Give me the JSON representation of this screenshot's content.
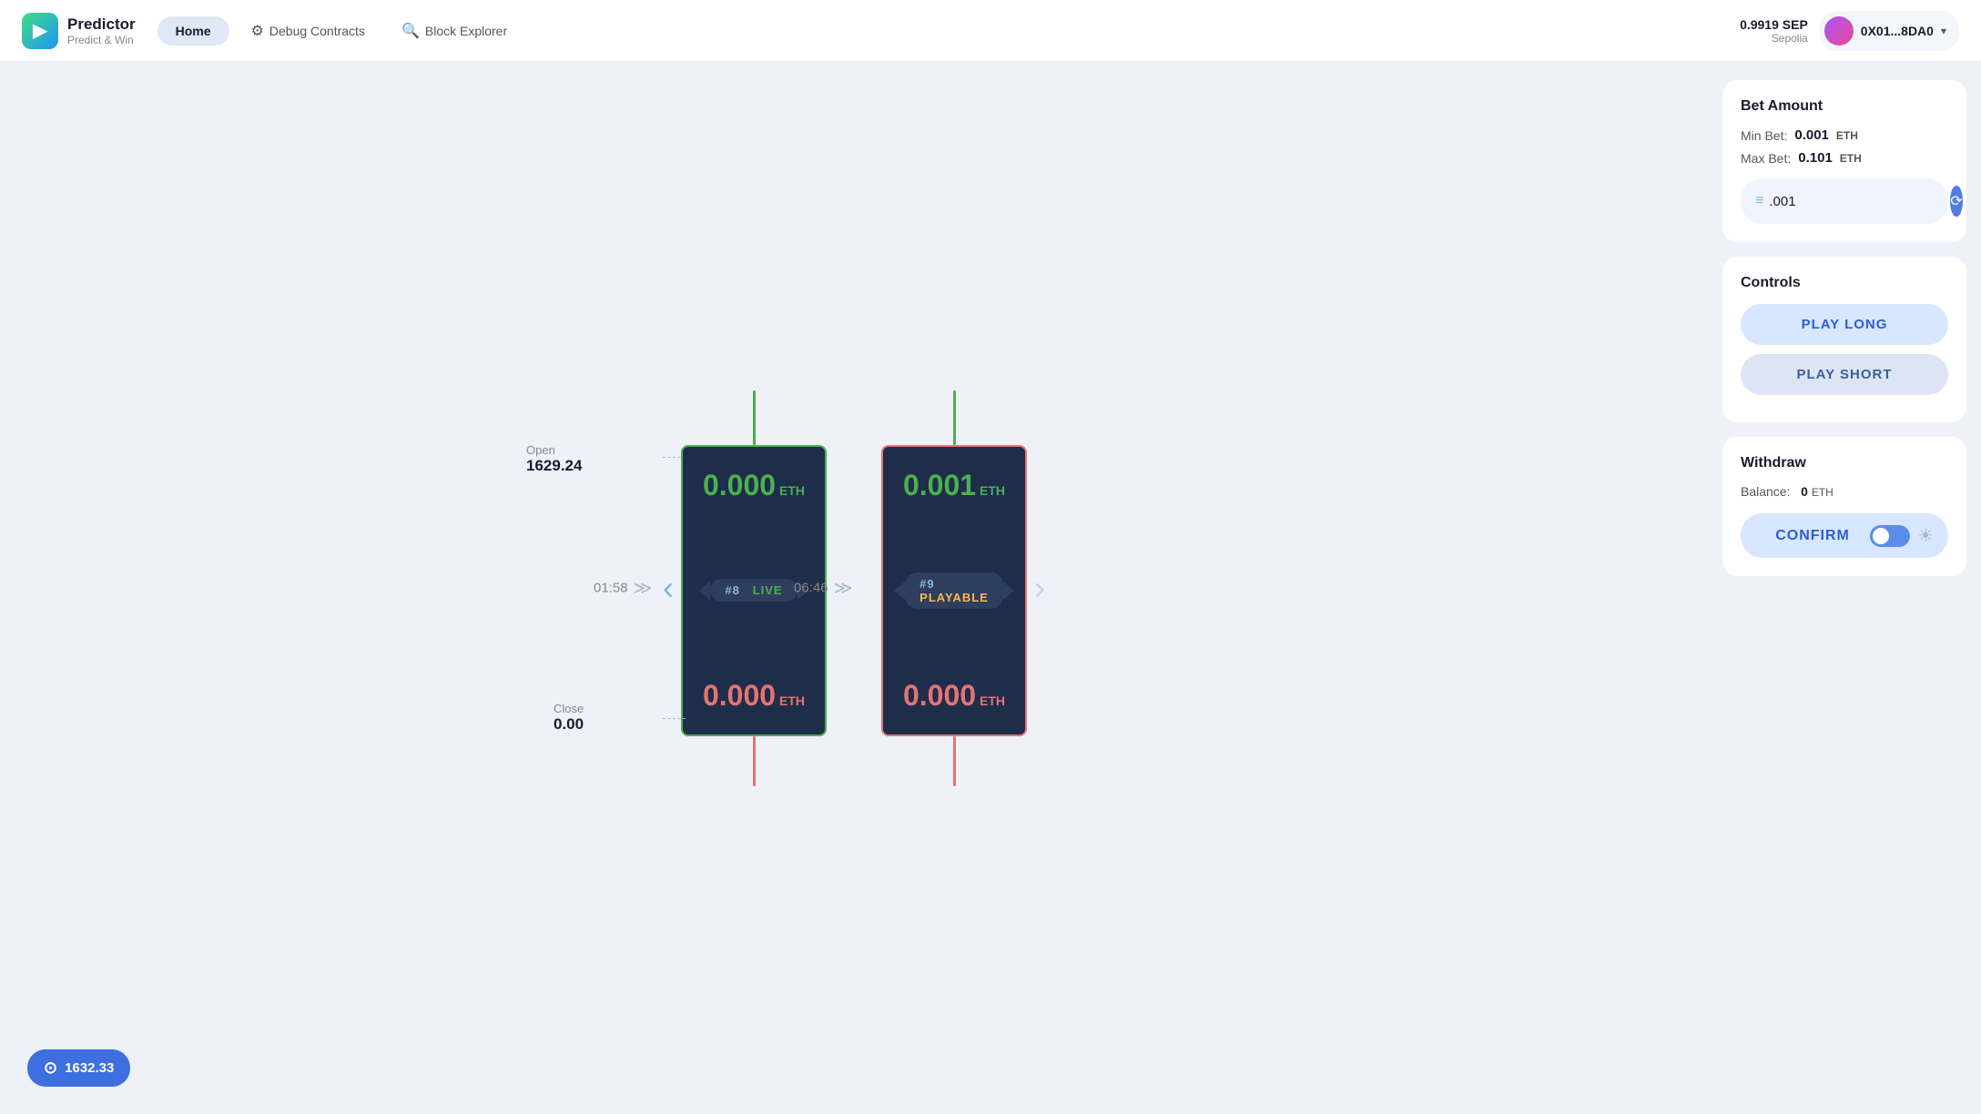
{
  "app": {
    "logo_title": "Predictor",
    "logo_sub": "Predict & Win"
  },
  "nav": {
    "home": "Home",
    "debug": "Debug Contracts",
    "explorer": "Block Explorer",
    "balance": "0.9919 SEP",
    "network": "Sepolia",
    "wallet_address": "0X01...8DA0"
  },
  "candles": [
    {
      "id": "candle-8",
      "badge_number": "#8",
      "badge_status": "LIVE",
      "badge_color": "green",
      "timer": "01:58",
      "top_value": "0.000",
      "bottom_value": "0.000",
      "eth_label": "ETH",
      "wick_top_color": "green",
      "wick_bottom_color": "red",
      "open_label": "Open",
      "open_price": "1629.24",
      "close_label": "Close",
      "close_price": "0.00"
    },
    {
      "id": "candle-9",
      "badge_number": "#9",
      "badge_status": "PLAYABLE",
      "badge_color": "orange",
      "timer": "06:46",
      "top_value": "0.001",
      "bottom_value": "0.000",
      "eth_label": "ETH",
      "wick_top_color": "green",
      "wick_bottom_color": "red"
    }
  ],
  "bet_amount": {
    "title": "Bet Amount",
    "min_label": "Min Bet:",
    "min_value": "0.001",
    "min_unit": "ETH",
    "max_label": "Max Bet:",
    "max_value": "0.101",
    "max_unit": "ETH",
    "input_value": ".001",
    "input_icon": "≡",
    "refresh_icon": "⟳"
  },
  "controls": {
    "title": "Controls",
    "play_long": "PLAY LONG",
    "play_short": "PLAY SHORT"
  },
  "withdraw": {
    "title": "Withdraw",
    "balance_label": "Balance:",
    "balance_value": "0",
    "balance_unit": "ETH",
    "confirm_label": "CONFIRM"
  },
  "price_ticker": {
    "value": "1632.33",
    "icon": "⊙"
  }
}
